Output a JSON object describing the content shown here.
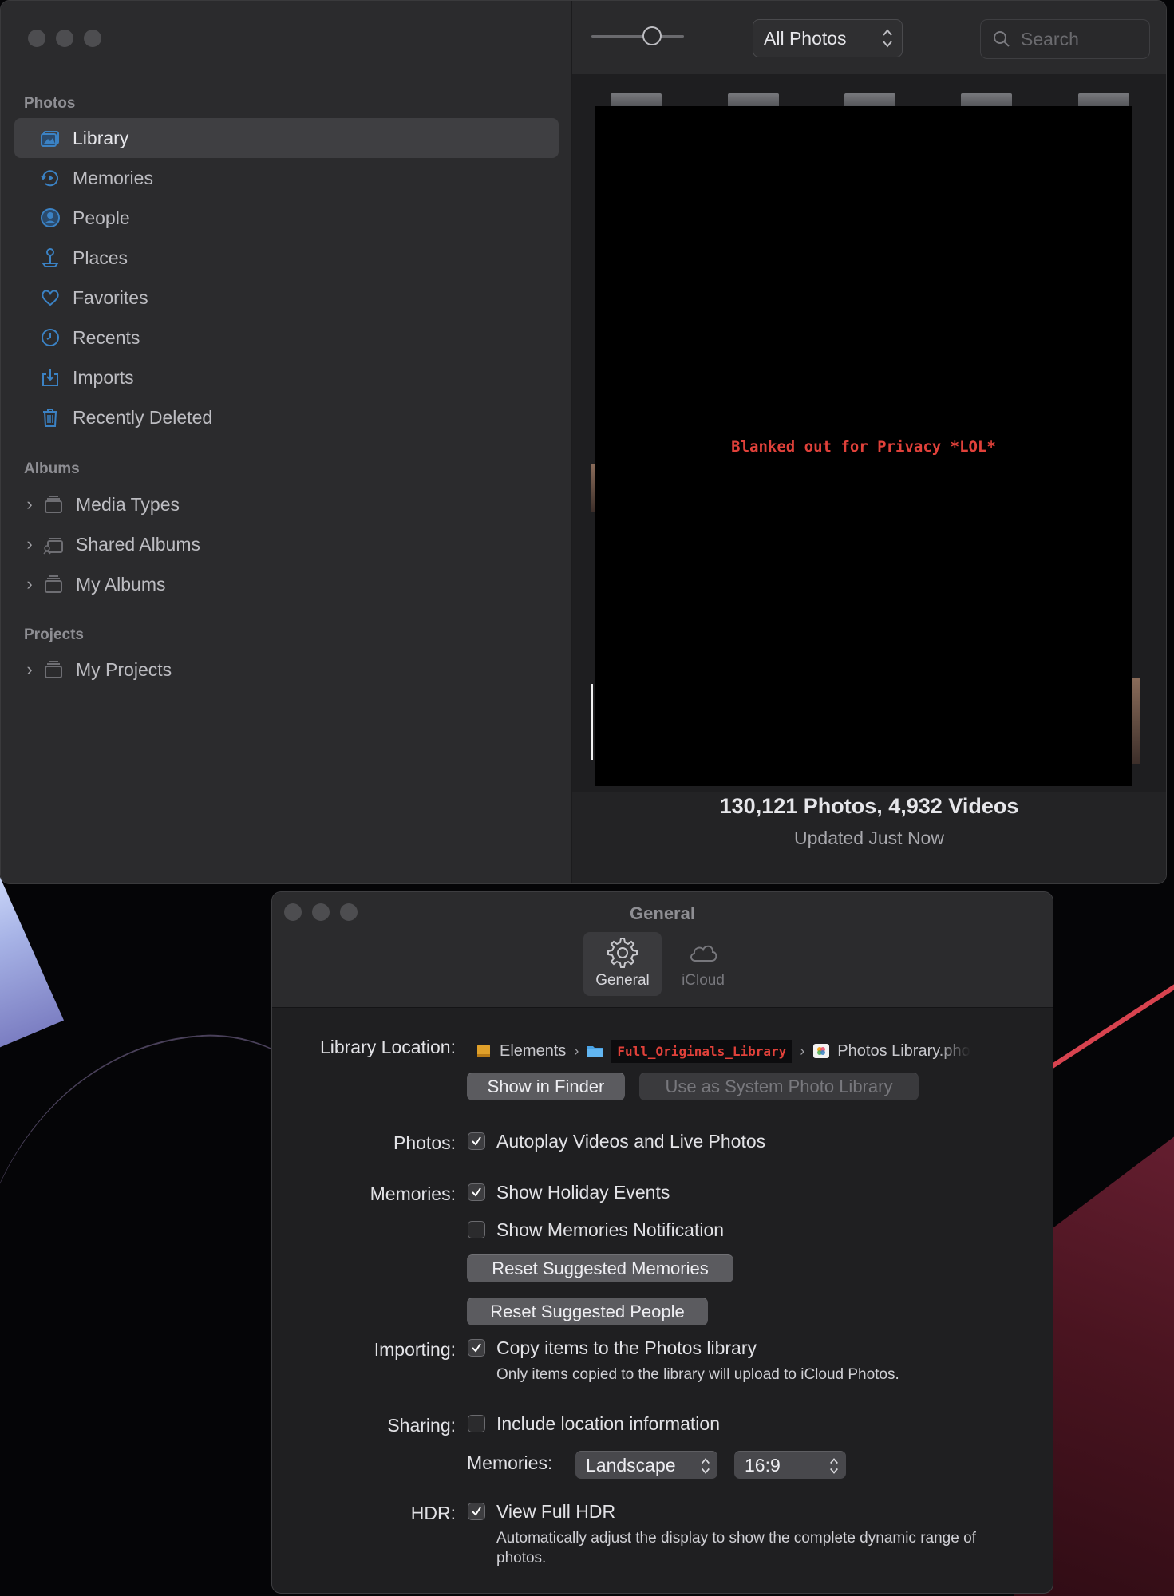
{
  "photos_window": {
    "sidebar": {
      "sections": {
        "photos": "Photos",
        "albums": "Albums",
        "projects": "Projects"
      },
      "library_items": [
        {
          "label": "Library",
          "icon": "library-icon"
        },
        {
          "label": "Memories",
          "icon": "memories-icon"
        },
        {
          "label": "People",
          "icon": "people-icon"
        },
        {
          "label": "Places",
          "icon": "places-icon"
        },
        {
          "label": "Favorites",
          "icon": "heart-icon"
        },
        {
          "label": "Recents",
          "icon": "clock-icon"
        },
        {
          "label": "Imports",
          "icon": "import-icon"
        },
        {
          "label": "Recently Deleted",
          "icon": "trash-icon"
        }
      ],
      "album_items": [
        {
          "label": "Media Types"
        },
        {
          "label": "Shared Albums"
        },
        {
          "label": "My Albums"
        }
      ],
      "project_items": [
        {
          "label": "My Projects"
        }
      ]
    },
    "toolbar": {
      "view_select": "All Photos",
      "search_placeholder": "Search",
      "zoom_level": 0.7
    },
    "content": {
      "privacy_note": "Blanked out for Privacy *LOL*",
      "counts": "130,121 Photos, 4,932 Videos",
      "status": "Updated Just Now"
    },
    "colors": {
      "accent": "#3b82c4",
      "privacy_text": "#e0413a"
    }
  },
  "settings_window": {
    "title": "General",
    "tabs": [
      {
        "label": "General",
        "icon": "gear-icon",
        "active": true
      },
      {
        "label": "iCloud",
        "icon": "cloud-icon",
        "active": false
      }
    ],
    "library_location": {
      "label": "Library Location:",
      "path": [
        {
          "label": "Elements",
          "icon": "drive-icon"
        },
        {
          "label": "Full_Originals_Library",
          "icon": "folder-icon"
        },
        {
          "label": "Photos Library.pho",
          "icon": "photos-library-icon"
        }
      ],
      "show_in_finder": "Show in Finder",
      "use_as_system": "Use as System Photo Library"
    },
    "photos": {
      "label": "Photos:",
      "autoplay": {
        "label": "Autoplay Videos and Live Photos",
        "checked": true
      }
    },
    "memories": {
      "label": "Memories:",
      "holiday": {
        "label": "Show Holiday Events",
        "checked": true
      },
      "notification": {
        "label": "Show Memories Notification",
        "checked": false
      },
      "reset_memories": "Reset Suggested Memories",
      "reset_people": "Reset Suggested People"
    },
    "importing": {
      "label": "Importing:",
      "copy": {
        "label": "Copy items to the Photos library",
        "checked": true
      },
      "help": "Only items copied to the library will upload to iCloud Photos."
    },
    "sharing": {
      "label": "Sharing:",
      "location": {
        "label": "Include location information",
        "checked": false
      },
      "memories_label": "Memories:",
      "orientation": "Landscape",
      "aspect": "16:9"
    },
    "hdr": {
      "label": "HDR:",
      "full_hdr": {
        "label": "View Full HDR",
        "checked": true
      },
      "help": "Automatically adjust the display to show the complete dynamic range of photos."
    }
  }
}
